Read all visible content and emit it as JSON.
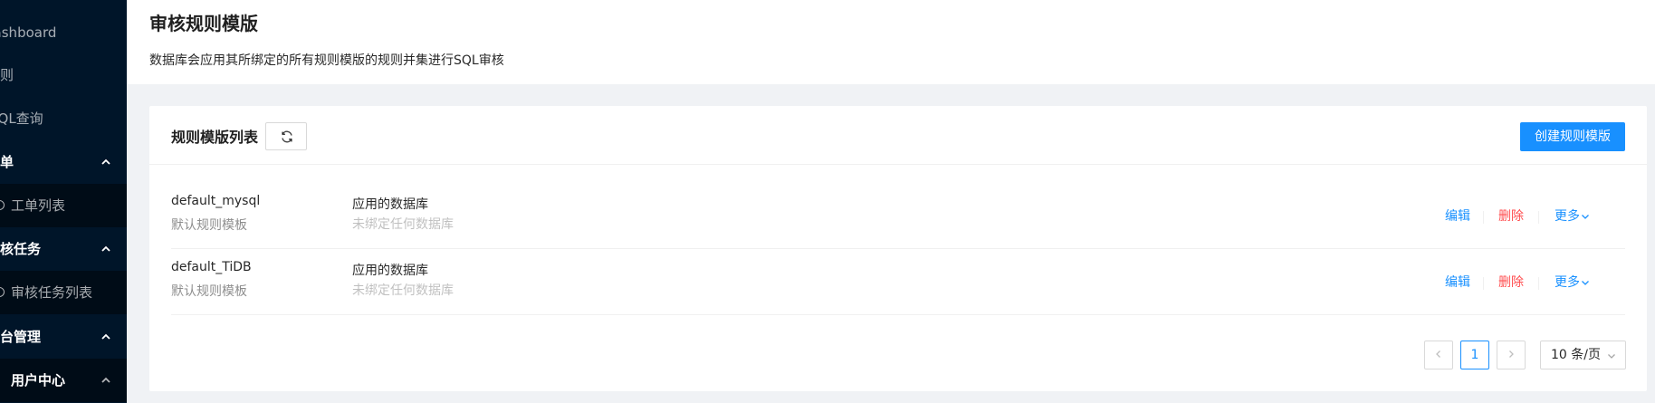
{
  "sidebar": {
    "items": [
      {
        "label": "Dashboard"
      },
      {
        "label": "规则"
      },
      {
        "label": "SQL查询"
      },
      {
        "label": "工单"
      },
      {
        "label": "工单列表"
      },
      {
        "label": "审核任务"
      },
      {
        "label": "审核任务列表"
      },
      {
        "label": "平台管理"
      },
      {
        "label": "用户中心"
      }
    ]
  },
  "header": {
    "title": "审核规则模版",
    "description": "数据库会应用其所绑定的所有规则模版的规则并集进行SQL审核"
  },
  "card": {
    "title": "规则模版列表",
    "create_label": "创建规则模版"
  },
  "templates": [
    {
      "name": "default_mysql",
      "desc": "默认规则模板",
      "db_title": "应用的数据库",
      "db_value": "未绑定任何数据库",
      "edit": "编辑",
      "delete": "删除",
      "more": "更多"
    },
    {
      "name": "default_TiDB",
      "desc": "默认规则模板",
      "db_title": "应用的数据库",
      "db_value": "未绑定任何数据库",
      "edit": "编辑",
      "delete": "删除",
      "more": "更多"
    }
  ],
  "pagination": {
    "prev": "<",
    "current": "1",
    "next": ">",
    "page_size": "10 条/页"
  },
  "colors": {
    "sidebar_bg": "#001529",
    "primary": "#1890ff",
    "danger": "#ff4d4f"
  }
}
